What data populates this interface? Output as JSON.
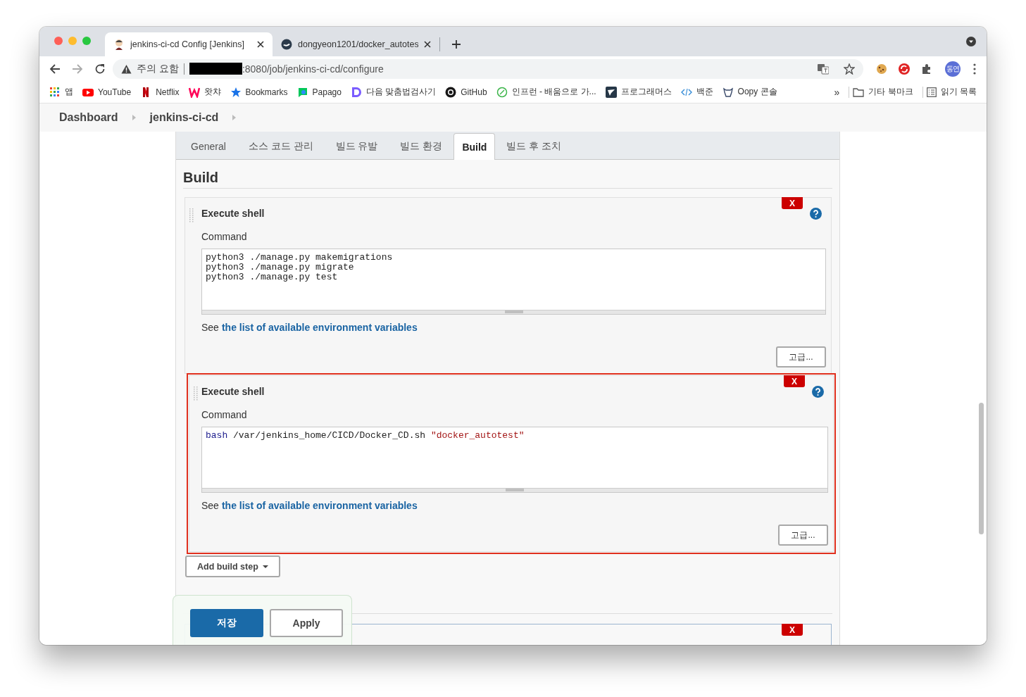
{
  "browser": {
    "tabs": [
      {
        "title": "jenkins-ci-cd Config [Jenkins]",
        "selected": true
      },
      {
        "title": "dongyeon1201/docker_autotes",
        "selected": false
      }
    ],
    "address": {
      "warning": "주의 요함",
      "url": ":8080/job/jenkins-ci-cd/configure"
    },
    "profile": "동연",
    "bookmarks": [
      "앱",
      "YouTube",
      "Netflix",
      "왓챠",
      "Bookmarks",
      "Papago",
      "다음 맞춤법검사기",
      "GitHub",
      "인프런 - 배움으로 가...",
      "프로그래머스",
      "백준",
      "Oopy 콘솔"
    ],
    "bookmarks_overflow": "»",
    "bookmark_folders": [
      "기타 북마크",
      "읽기 목록"
    ]
  },
  "breadcrumbs": [
    "Dashboard",
    "jenkins-ci-cd"
  ],
  "config_tabs": [
    {
      "label": "General",
      "selected": false
    },
    {
      "label": "소스 코드 관리",
      "selected": false
    },
    {
      "label": "빌드 유발",
      "selected": false
    },
    {
      "label": "빌드 환경",
      "selected": false
    },
    {
      "label": "Build",
      "selected": true
    },
    {
      "label": "빌드 후 조치",
      "selected": false
    }
  ],
  "section_title": "Build",
  "steps": [
    {
      "title": "Execute shell",
      "label": "Command",
      "highlighted": false,
      "delete": "X",
      "help_prefix": "See",
      "help_link": "the list of available environment variables",
      "advanced": "고급...",
      "lines": [
        [
          {
            "text": "python3 ./manage.py makemigrations",
            "kind": "plain"
          }
        ],
        [
          {
            "text": "python3 ./manage.py migrate",
            "kind": "plain"
          }
        ],
        [
          {
            "text": "python3 ./manage.py test",
            "kind": "plain"
          }
        ]
      ]
    },
    {
      "title": "Execute shell",
      "label": "Command",
      "highlighted": true,
      "delete": "X",
      "help_prefix": "See",
      "help_link": "the list of available environment variables",
      "advanced": "고급...",
      "lines": [
        [
          {
            "text": "bash",
            "kind": "keyword"
          },
          {
            "text": " /var/jenkins_home/CICD/Docker_CD.sh ",
            "kind": "plain"
          },
          {
            "text": "\"docker_autotest\"",
            "kind": "string"
          }
        ]
      ]
    }
  ],
  "add_step": "Add build step",
  "next_step_delete": "X",
  "save": "저장",
  "apply": "Apply"
}
